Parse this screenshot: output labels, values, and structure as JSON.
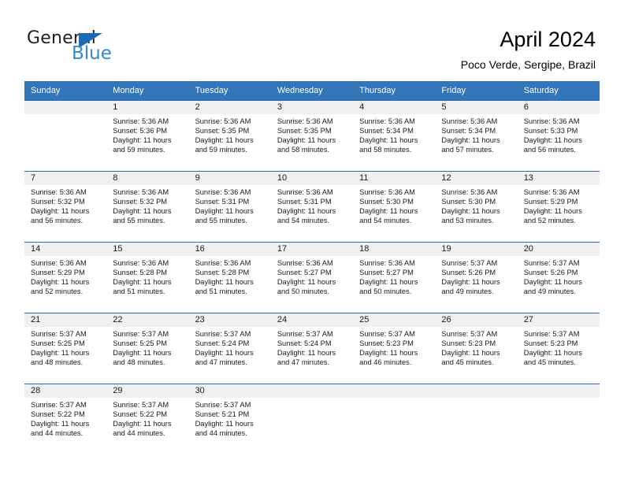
{
  "brand": {
    "name_part1": "General",
    "name_part2": "Blue",
    "triangle_color": "#1b6cb3",
    "blue_color": "#2e8bd4"
  },
  "header": {
    "title": "April 2024",
    "subtitle": "Poco Verde, Sergipe, Brazil"
  },
  "theme": {
    "header_bg": "#3275b8",
    "week_separator": "#2d6ca8",
    "daynum_band": "#f0f0f0",
    "text": "#1a1a1a"
  },
  "calendar": {
    "weekday_headers": [
      "Sunday",
      "Monday",
      "Tuesday",
      "Wednesday",
      "Thursday",
      "Friday",
      "Saturday"
    ],
    "weeks": [
      [
        {
          "day": "",
          "sunrise": "",
          "sunset": "",
          "daylight_line1": "",
          "daylight_line2": ""
        },
        {
          "day": "1",
          "sunrise": "Sunrise: 5:36 AM",
          "sunset": "Sunset: 5:36 PM",
          "daylight_line1": "Daylight: 11 hours",
          "daylight_line2": "and 59 minutes."
        },
        {
          "day": "2",
          "sunrise": "Sunrise: 5:36 AM",
          "sunset": "Sunset: 5:35 PM",
          "daylight_line1": "Daylight: 11 hours",
          "daylight_line2": "and 59 minutes."
        },
        {
          "day": "3",
          "sunrise": "Sunrise: 5:36 AM",
          "sunset": "Sunset: 5:35 PM",
          "daylight_line1": "Daylight: 11 hours",
          "daylight_line2": "and 58 minutes."
        },
        {
          "day": "4",
          "sunrise": "Sunrise: 5:36 AM",
          "sunset": "Sunset: 5:34 PM",
          "daylight_line1": "Daylight: 11 hours",
          "daylight_line2": "and 58 minutes."
        },
        {
          "day": "5",
          "sunrise": "Sunrise: 5:36 AM",
          "sunset": "Sunset: 5:34 PM",
          "daylight_line1": "Daylight: 11 hours",
          "daylight_line2": "and 57 minutes."
        },
        {
          "day": "6",
          "sunrise": "Sunrise: 5:36 AM",
          "sunset": "Sunset: 5:33 PM",
          "daylight_line1": "Daylight: 11 hours",
          "daylight_line2": "and 56 minutes."
        }
      ],
      [
        {
          "day": "7",
          "sunrise": "Sunrise: 5:36 AM",
          "sunset": "Sunset: 5:32 PM",
          "daylight_line1": "Daylight: 11 hours",
          "daylight_line2": "and 56 minutes."
        },
        {
          "day": "8",
          "sunrise": "Sunrise: 5:36 AM",
          "sunset": "Sunset: 5:32 PM",
          "daylight_line1": "Daylight: 11 hours",
          "daylight_line2": "and 55 minutes."
        },
        {
          "day": "9",
          "sunrise": "Sunrise: 5:36 AM",
          "sunset": "Sunset: 5:31 PM",
          "daylight_line1": "Daylight: 11 hours",
          "daylight_line2": "and 55 minutes."
        },
        {
          "day": "10",
          "sunrise": "Sunrise: 5:36 AM",
          "sunset": "Sunset: 5:31 PM",
          "daylight_line1": "Daylight: 11 hours",
          "daylight_line2": "and 54 minutes."
        },
        {
          "day": "11",
          "sunrise": "Sunrise: 5:36 AM",
          "sunset": "Sunset: 5:30 PM",
          "daylight_line1": "Daylight: 11 hours",
          "daylight_line2": "and 54 minutes."
        },
        {
          "day": "12",
          "sunrise": "Sunrise: 5:36 AM",
          "sunset": "Sunset: 5:30 PM",
          "daylight_line1": "Daylight: 11 hours",
          "daylight_line2": "and 53 minutes."
        },
        {
          "day": "13",
          "sunrise": "Sunrise: 5:36 AM",
          "sunset": "Sunset: 5:29 PM",
          "daylight_line1": "Daylight: 11 hours",
          "daylight_line2": "and 52 minutes."
        }
      ],
      [
        {
          "day": "14",
          "sunrise": "Sunrise: 5:36 AM",
          "sunset": "Sunset: 5:29 PM",
          "daylight_line1": "Daylight: 11 hours",
          "daylight_line2": "and 52 minutes."
        },
        {
          "day": "15",
          "sunrise": "Sunrise: 5:36 AM",
          "sunset": "Sunset: 5:28 PM",
          "daylight_line1": "Daylight: 11 hours",
          "daylight_line2": "and 51 minutes."
        },
        {
          "day": "16",
          "sunrise": "Sunrise: 5:36 AM",
          "sunset": "Sunset: 5:28 PM",
          "daylight_line1": "Daylight: 11 hours",
          "daylight_line2": "and 51 minutes."
        },
        {
          "day": "17",
          "sunrise": "Sunrise: 5:36 AM",
          "sunset": "Sunset: 5:27 PM",
          "daylight_line1": "Daylight: 11 hours",
          "daylight_line2": "and 50 minutes."
        },
        {
          "day": "18",
          "sunrise": "Sunrise: 5:36 AM",
          "sunset": "Sunset: 5:27 PM",
          "daylight_line1": "Daylight: 11 hours",
          "daylight_line2": "and 50 minutes."
        },
        {
          "day": "19",
          "sunrise": "Sunrise: 5:37 AM",
          "sunset": "Sunset: 5:26 PM",
          "daylight_line1": "Daylight: 11 hours",
          "daylight_line2": "and 49 minutes."
        },
        {
          "day": "20",
          "sunrise": "Sunrise: 5:37 AM",
          "sunset": "Sunset: 5:26 PM",
          "daylight_line1": "Daylight: 11 hours",
          "daylight_line2": "and 49 minutes."
        }
      ],
      [
        {
          "day": "21",
          "sunrise": "Sunrise: 5:37 AM",
          "sunset": "Sunset: 5:25 PM",
          "daylight_line1": "Daylight: 11 hours",
          "daylight_line2": "and 48 minutes."
        },
        {
          "day": "22",
          "sunrise": "Sunrise: 5:37 AM",
          "sunset": "Sunset: 5:25 PM",
          "daylight_line1": "Daylight: 11 hours",
          "daylight_line2": "and 48 minutes."
        },
        {
          "day": "23",
          "sunrise": "Sunrise: 5:37 AM",
          "sunset": "Sunset: 5:24 PM",
          "daylight_line1": "Daylight: 11 hours",
          "daylight_line2": "and 47 minutes."
        },
        {
          "day": "24",
          "sunrise": "Sunrise: 5:37 AM",
          "sunset": "Sunset: 5:24 PM",
          "daylight_line1": "Daylight: 11 hours",
          "daylight_line2": "and 47 minutes."
        },
        {
          "day": "25",
          "sunrise": "Sunrise: 5:37 AM",
          "sunset": "Sunset: 5:23 PM",
          "daylight_line1": "Daylight: 11 hours",
          "daylight_line2": "and 46 minutes."
        },
        {
          "day": "26",
          "sunrise": "Sunrise: 5:37 AM",
          "sunset": "Sunset: 5:23 PM",
          "daylight_line1": "Daylight: 11 hours",
          "daylight_line2": "and 45 minutes."
        },
        {
          "day": "27",
          "sunrise": "Sunrise: 5:37 AM",
          "sunset": "Sunset: 5:23 PM",
          "daylight_line1": "Daylight: 11 hours",
          "daylight_line2": "and 45 minutes."
        }
      ],
      [
        {
          "day": "28",
          "sunrise": "Sunrise: 5:37 AM",
          "sunset": "Sunset: 5:22 PM",
          "daylight_line1": "Daylight: 11 hours",
          "daylight_line2": "and 44 minutes."
        },
        {
          "day": "29",
          "sunrise": "Sunrise: 5:37 AM",
          "sunset": "Sunset: 5:22 PM",
          "daylight_line1": "Daylight: 11 hours",
          "daylight_line2": "and 44 minutes."
        },
        {
          "day": "30",
          "sunrise": "Sunrise: 5:37 AM",
          "sunset": "Sunset: 5:21 PM",
          "daylight_line1": "Daylight: 11 hours",
          "daylight_line2": "and 44 minutes."
        },
        {
          "day": "",
          "sunrise": "",
          "sunset": "",
          "daylight_line1": "",
          "daylight_line2": ""
        },
        {
          "day": "",
          "sunrise": "",
          "sunset": "",
          "daylight_line1": "",
          "daylight_line2": ""
        },
        {
          "day": "",
          "sunrise": "",
          "sunset": "",
          "daylight_line1": "",
          "daylight_line2": ""
        },
        {
          "day": "",
          "sunrise": "",
          "sunset": "",
          "daylight_line1": "",
          "daylight_line2": ""
        }
      ]
    ]
  }
}
